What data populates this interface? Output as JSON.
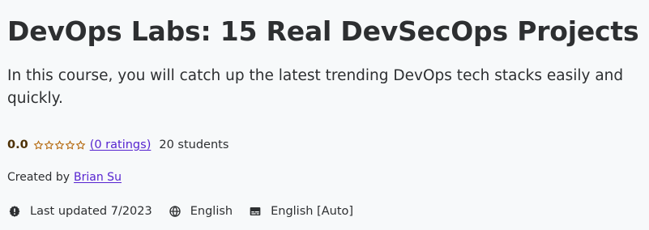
{
  "course": {
    "title": "DevOps Labs: 15 Real DevSecOps Projects",
    "subtitle": "In this course, you will catch up the latest trending DevOps tech stacks easily and quickly."
  },
  "rating": {
    "value": "0.0",
    "stars_filled": 0,
    "stars_total": 5,
    "ratings_link": "(0 ratings)",
    "students": "20 students"
  },
  "instructor": {
    "label": "Created by",
    "name": "Brian Su"
  },
  "meta": {
    "last_updated": "Last updated 7/2023",
    "language": "English",
    "captions": "English [Auto]"
  },
  "colors": {
    "background": "#f7f9fa",
    "text": "#2d2f31",
    "link": "#5624d0",
    "rating": "#b4690e"
  },
  "icons": {
    "last_updated": "alert-badge-icon",
    "language": "globe-icon",
    "captions": "closed-captions-icon",
    "rating": "star-outline-icon"
  }
}
